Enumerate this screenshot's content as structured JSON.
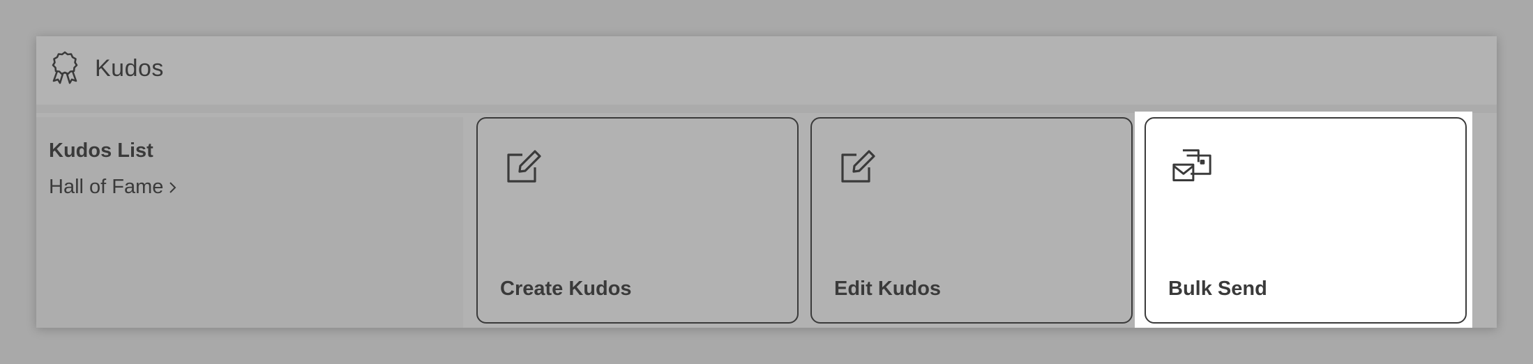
{
  "header": {
    "title": "Kudos",
    "icon": "award-ribbon-icon"
  },
  "sidebar": {
    "heading": "Kudos List",
    "link_label": "Hall of Fame",
    "link_icon": "chevron-right-icon"
  },
  "cards": [
    {
      "label": "Create Kudos",
      "icon": "edit-square-icon",
      "active": false
    },
    {
      "label": "Edit Kudos",
      "icon": "edit-square-icon",
      "active": false
    },
    {
      "label": "Bulk Send",
      "icon": "bulk-mail-icon",
      "active": true
    }
  ],
  "colors": {
    "backdrop": "#a9a9a9",
    "panel": "#b2b2b2",
    "text": "#3a3a3a",
    "active_card": "#ffffff"
  }
}
